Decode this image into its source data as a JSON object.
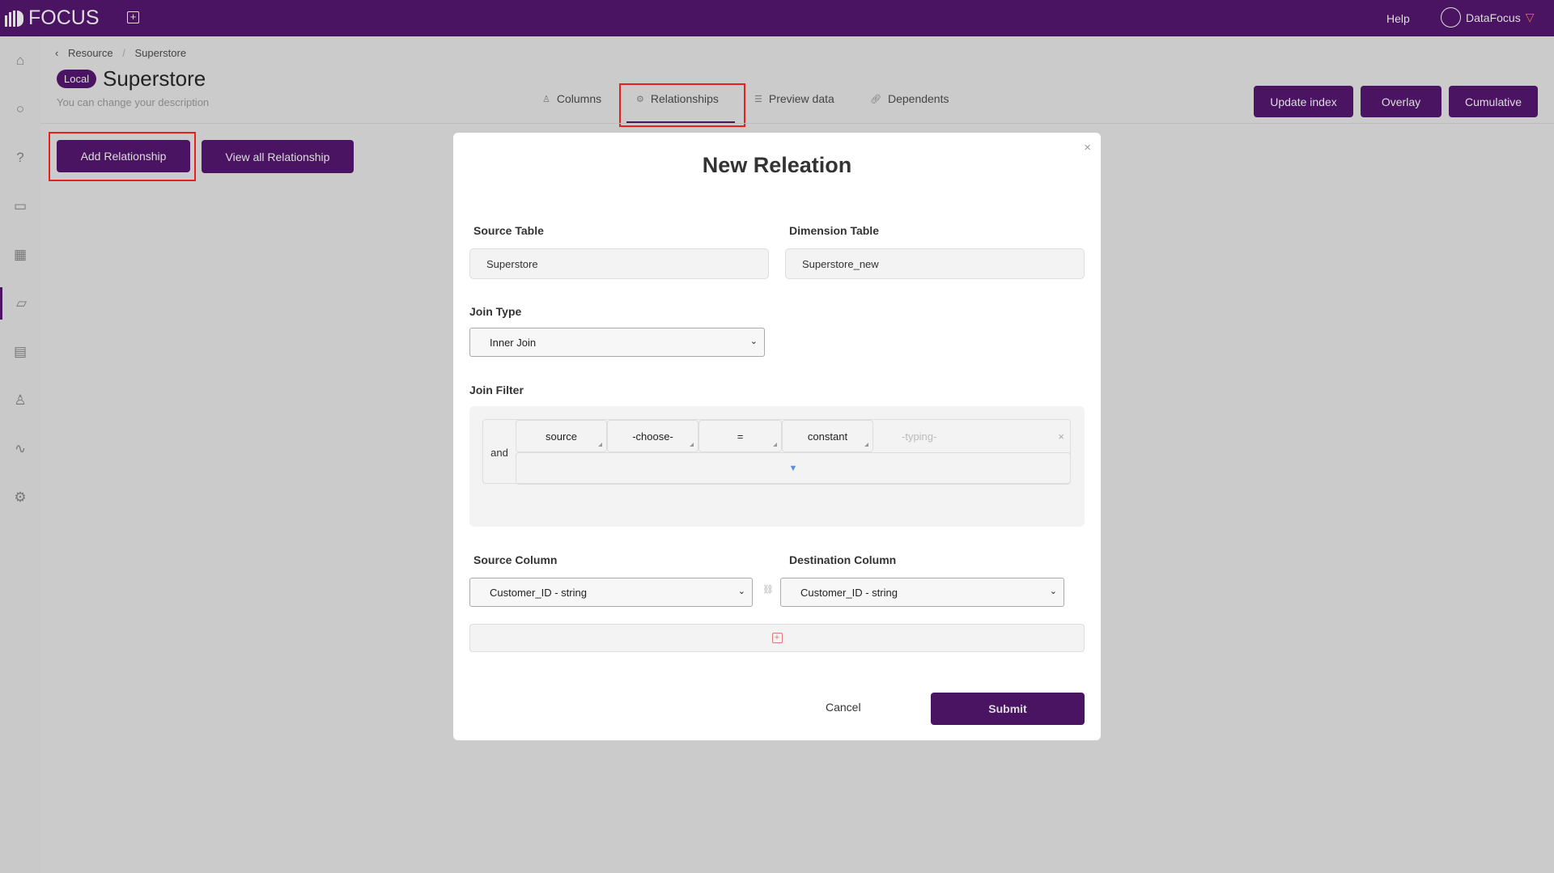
{
  "header": {
    "brand": "FOCUS",
    "help": "Help",
    "user": "DataFocus",
    "accent": "#4a1462"
  },
  "sidebar": {
    "items": [
      "home-icon",
      "search-icon",
      "help-icon",
      "dashboard-icon",
      "table-icon",
      "folder-icon",
      "clipboard-icon",
      "user-icon",
      "activity-icon",
      "settings-icon"
    ],
    "active": "folder-icon"
  },
  "breadcrumb": {
    "back": "Resource",
    "sep": "/",
    "current": "Superstore"
  },
  "page": {
    "badge": "Local",
    "title": "Superstore",
    "description": "You can change your description"
  },
  "tabs": [
    {
      "label": "Columns"
    },
    {
      "label": "Relationships"
    },
    {
      "label": "Preview data"
    },
    {
      "label": "Dependents"
    }
  ],
  "actions": {
    "update_index": "Update index",
    "overlay": "Overlay",
    "cumulative": "Cumulative",
    "add_relationship": "Add Relationship",
    "view_all": "View all Relationship"
  },
  "modal": {
    "title": "New Releation",
    "close": "×",
    "source_table_label": "Source Table",
    "source_table": "Superstore",
    "dimension_table_label": "Dimension Table",
    "dimension_table": "Superstore_new",
    "join_type_label": "Join Type",
    "join_type": "Inner Join",
    "join_filter_label": "Join Filter",
    "filter": {
      "connector": "and",
      "source": "source",
      "field": "-choose-",
      "operator": "=",
      "value_type": "constant",
      "value_placeholder": "-typing-",
      "remove": "×",
      "expand": "▼"
    },
    "source_column_label": "Source Column",
    "source_column": "Customer_ID - string",
    "destination_column_label": "Destination Column",
    "destination_column": "Customer_ID - string",
    "cancel": "Cancel",
    "submit": "Submit"
  }
}
